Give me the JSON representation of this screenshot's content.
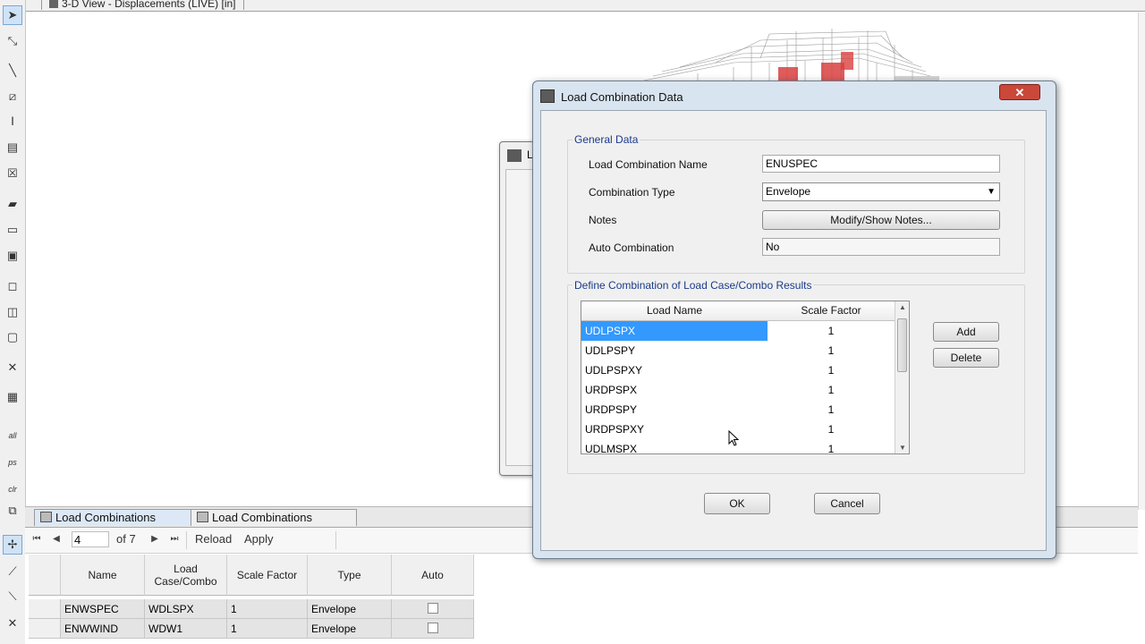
{
  "view": {
    "title": "3-D View   - Displacements (LIVE)  [in]"
  },
  "left_toolbar": {
    "text_buttons": [
      "all",
      "ps",
      "clr"
    ]
  },
  "back_dialog": {
    "title_fragment": "L"
  },
  "bottom_panel": {
    "tabs": [
      {
        "label": "Load Combinations"
      },
      {
        "label": "Load Combinations"
      }
    ],
    "nav": {
      "page_value": "4",
      "of_text": "of 7",
      "reload_label": "Reload",
      "apply_label": "Apply"
    },
    "grid": {
      "headers": [
        "Name",
        "Load\nCase/Combo",
        "Scale Factor",
        "Type",
        "Auto"
      ],
      "rows": [
        {
          "name": "ENWSPEC",
          "load": "WDLSPX",
          "sf": "1",
          "type": "Envelope"
        },
        {
          "name": "ENWWIND",
          "load": "WDW1",
          "sf": "1",
          "type": "Envelope"
        }
      ]
    }
  },
  "dialog": {
    "title": "Load Combination Data",
    "close_label": "✕",
    "general": {
      "label": "General Data",
      "name_label": "Load Combination Name",
      "name_value": "ENUSPEC",
      "type_label": "Combination Type",
      "type_value": "Envelope",
      "notes_label": "Notes",
      "notes_button": "Modify/Show Notes...",
      "auto_label": "Auto Combination",
      "auto_value": "No"
    },
    "define": {
      "label": "Define Combination of Load Case/Combo Results",
      "col_name": "Load Name",
      "col_sf": "Scale Factor",
      "rows": [
        {
          "name": "UDLPSPX",
          "sf": "1"
        },
        {
          "name": "UDLPSPY",
          "sf": "1"
        },
        {
          "name": "UDLPSPXY",
          "sf": "1"
        },
        {
          "name": "URDPSPX",
          "sf": "1"
        },
        {
          "name": "URDPSPY",
          "sf": "1"
        },
        {
          "name": "URDPSPXY",
          "sf": "1"
        },
        {
          "name": "UDLMSPX",
          "sf": "1"
        }
      ],
      "add_label": "Add",
      "delete_label": "Delete"
    },
    "ok_label": "OK",
    "cancel_label": "Cancel"
  },
  "colors": {
    "selection": "#3399ff",
    "group_label": "#1a3a8a",
    "close_button": "#c9483a"
  }
}
